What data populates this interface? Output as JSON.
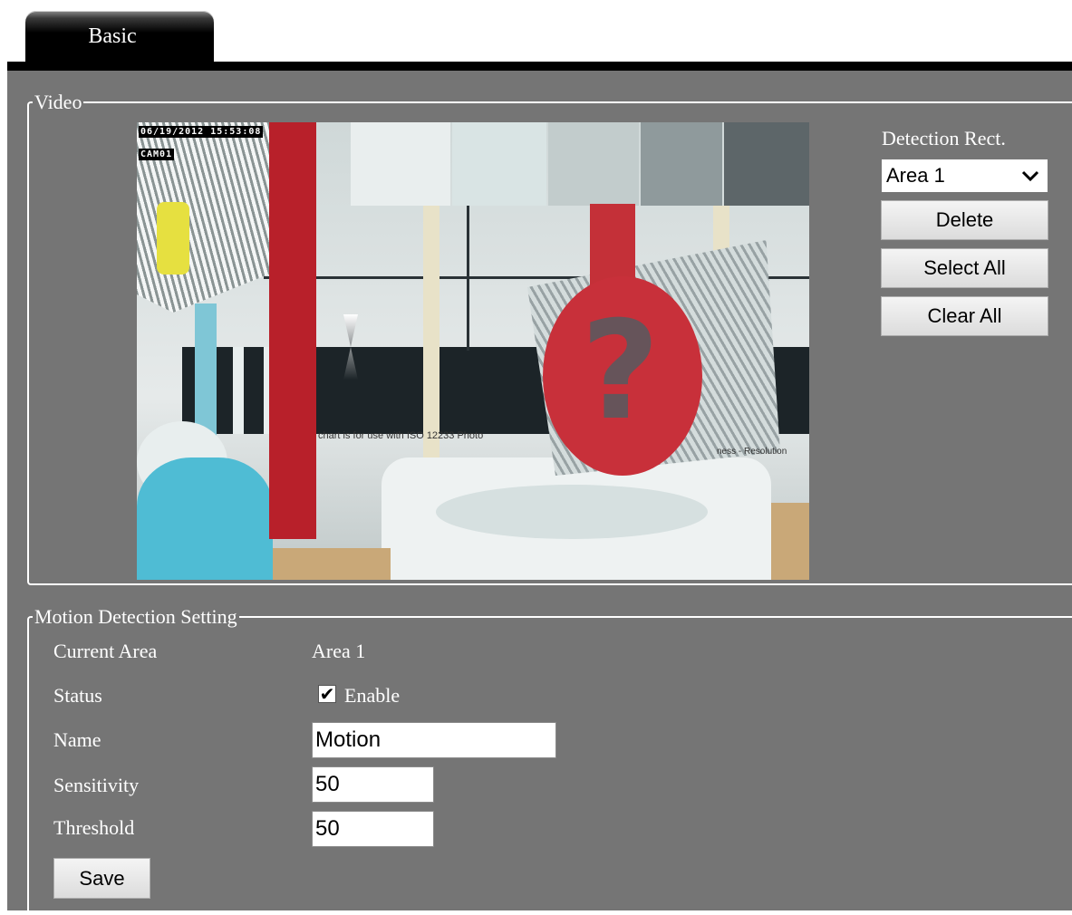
{
  "tabs": [
    {
      "label": "Basic",
      "active": true
    }
  ],
  "video_section": {
    "legend": "Video",
    "osd": {
      "timestamp": "06/19/2012 15:53:08",
      "camera": "CAM01"
    }
  },
  "detection": {
    "label": "Detection Rect.",
    "selected_area": "Area 1",
    "delete_label": "Delete",
    "select_all_label": "Select All",
    "clear_all_label": "Clear All"
  },
  "motion": {
    "legend": "Motion Detection Setting",
    "current_area_label": "Current Area",
    "current_area_value": "Area 1",
    "status_label": "Status",
    "enable_label": "Enable",
    "enable_checked": true,
    "name_label": "Name",
    "name_value": "Motion",
    "sensitivity_label": "Sensitivity",
    "sensitivity_value": "50",
    "threshold_label": "Threshold",
    "threshold_value": "50",
    "save_label": "Save"
  },
  "colors": {
    "panel_bg": "#757575",
    "tab_bg": "#000000",
    "frame": "#ffffff"
  }
}
